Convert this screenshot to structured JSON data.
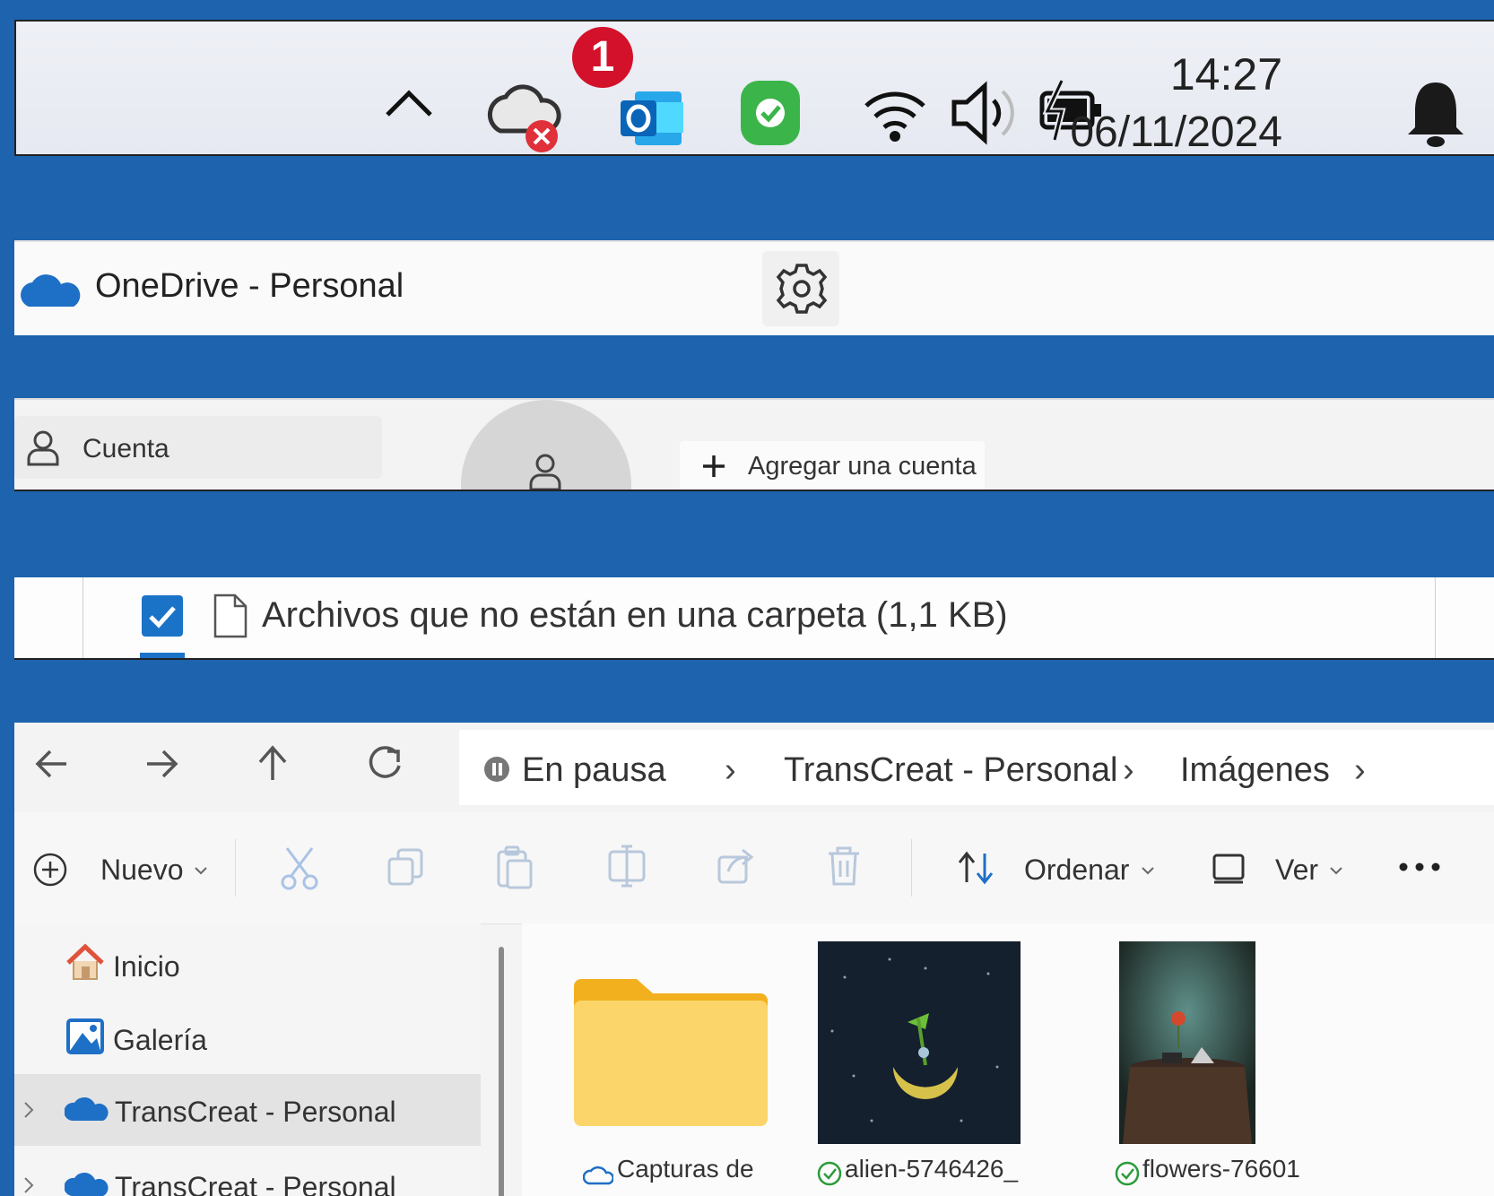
{
  "taskbar": {
    "badge_count": "1",
    "time": "14:27",
    "date": "06/11/2024",
    "icons": [
      "chevron-up-icon",
      "onedrive-error-icon",
      "outlook-icon",
      "security-check-icon",
      "wifi-icon",
      "volume-icon",
      "battery-charging-icon",
      "notification-bell-icon"
    ]
  },
  "onedrive": {
    "title": "OneDrive - Personal"
  },
  "account": {
    "tab_label": "Cuenta",
    "add_label": "Agregar una cuenta"
  },
  "files": {
    "label": "Archivos que no están en una carpeta  (1,1 KB)",
    "checked": true
  },
  "explorer": {
    "breadcrumb": [
      "En pausa",
      "TransCreat - Personal",
      "Imágenes"
    ],
    "toolbar": {
      "new_label": "Nuevo",
      "sort_label": "Ordenar",
      "view_label": "Ver"
    },
    "sidebar": [
      {
        "label": "Inicio"
      },
      {
        "label": "Galería"
      },
      {
        "label": "TransCreat - Personal"
      },
      {
        "label": "TransCreat - Personal"
      }
    ],
    "items": [
      {
        "name": "Capturas de"
      },
      {
        "name": "alien-5746426_"
      },
      {
        "name": "flowers-76601"
      }
    ]
  },
  "colors": {
    "background": "#1d63ad",
    "accent": "#1e6fc6",
    "badge": "#d3112a",
    "security": "#3bb54a",
    "outlook": "#1471c6",
    "folder": "#f8c53a"
  }
}
